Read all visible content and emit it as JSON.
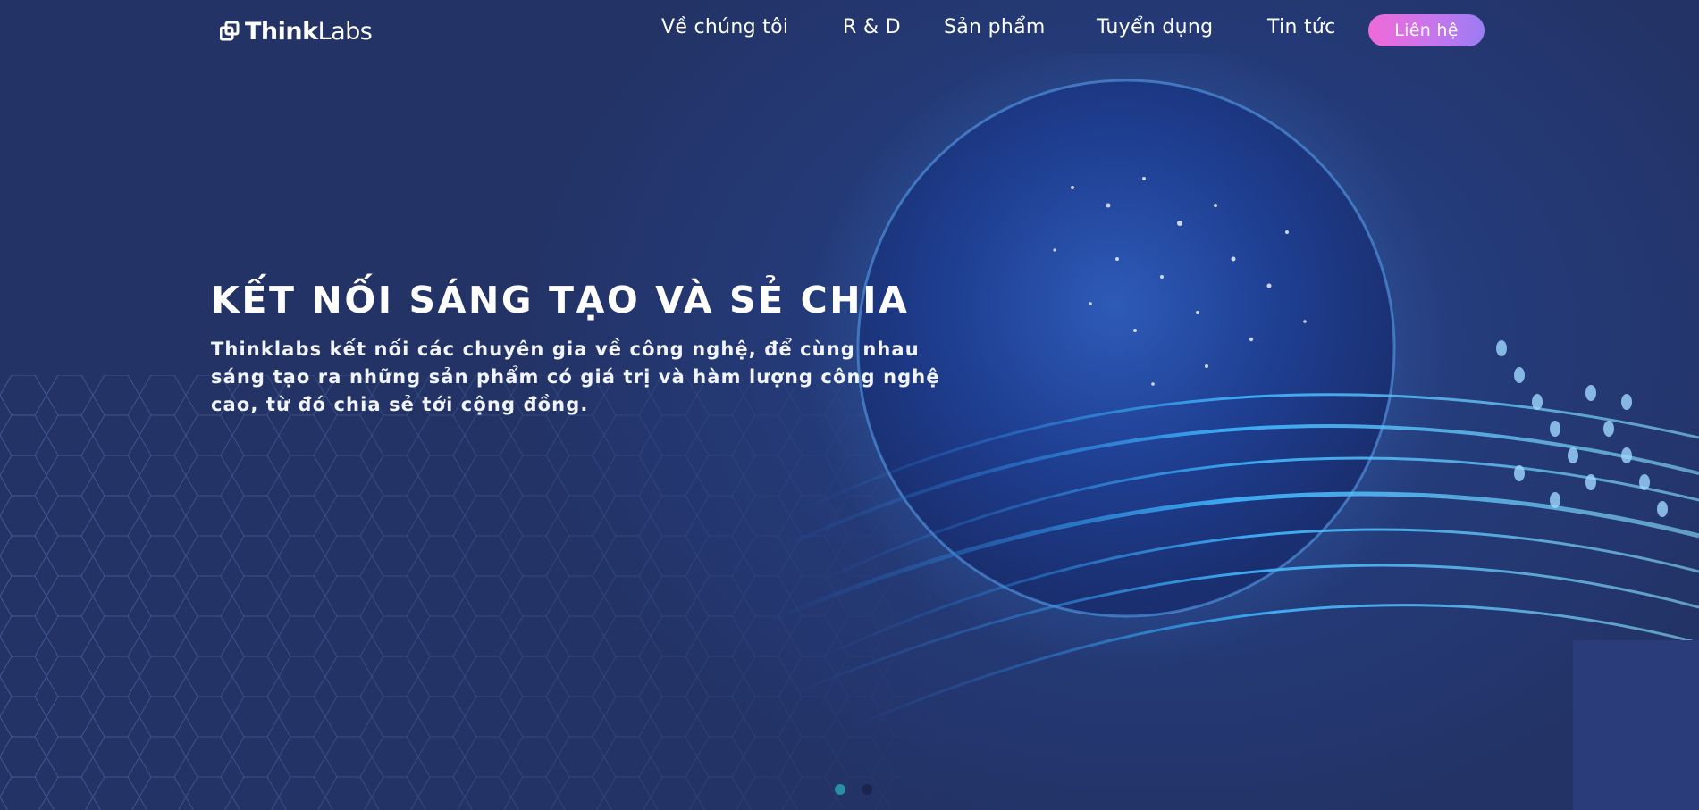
{
  "brand": {
    "logo_bold": "Think",
    "logo_light": "Labs"
  },
  "nav": {
    "items": [
      {
        "label": "Về chúng tôi"
      },
      {
        "label": "R & D"
      },
      {
        "label": "Sản phẩm"
      },
      {
        "label": "Tuyển dụng"
      },
      {
        "label": "Tin tức"
      }
    ],
    "contact_label": "Liên hệ"
  },
  "hero": {
    "headline": "KẾT NỐI SÁNG TẠO VÀ SẺ CHIA",
    "description": "Thinklabs kết nối các chuyên gia về công nghệ, để cùng nhau sáng tạo ra những sản phẩm có giá trị và hàm lượng công nghệ cao, từ đó chia sẻ tới cộng đồng."
  },
  "carousel": {
    "active_index": 0,
    "count": 2
  },
  "colors": {
    "background": "#233366",
    "contact_gradient_start": "#f06ad8",
    "contact_gradient_end": "#9b7cf3",
    "dot_active": "#2a8fa3",
    "dot_inactive": "#1b2550"
  },
  "icons": {
    "logo": "thinklabs-logo-icon",
    "hero_image": "globe-network-icon"
  }
}
